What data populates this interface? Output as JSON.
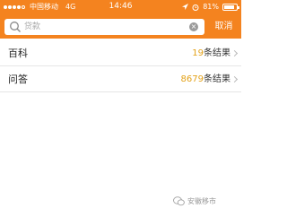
{
  "status_bar": {
    "carrier": "中国移动",
    "network": "4G",
    "time": "14:46",
    "battery": "81%",
    "battery_level": 0.81
  },
  "search": {
    "value": "贷款",
    "cancel_label": "取消"
  },
  "results": [
    {
      "label": "百科",
      "count": "19",
      "suffix": "条结果"
    },
    {
      "label": "问答",
      "count": "8679",
      "suffix": "条结果"
    }
  ],
  "watermark": {
    "text": "安徽移市"
  },
  "colors": {
    "header": "#f4831f",
    "count": "#e3a21a"
  }
}
